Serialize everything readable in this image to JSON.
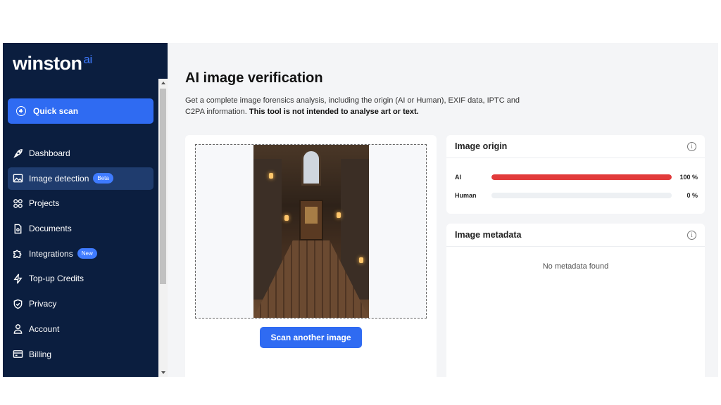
{
  "app": {
    "logo_text": "winston",
    "logo_suffix": "ai",
    "accent_color": "#2f6bf2",
    "sidebar_color": "#0b1e3f"
  },
  "sidebar": {
    "quick_scan": "Quick scan",
    "items": [
      {
        "label": "Dashboard",
        "icon": "rocket-icon"
      },
      {
        "label": "Image detection",
        "icon": "image-icon",
        "tag": "Beta",
        "active": true
      },
      {
        "label": "Projects",
        "icon": "grid-icon"
      },
      {
        "label": "Documents",
        "icon": "document-icon"
      },
      {
        "label": "Integrations",
        "icon": "puzzle-icon",
        "tag": "New"
      },
      {
        "label": "Top-up Credits",
        "icon": "lightning-icon"
      },
      {
        "label": "Privacy",
        "icon": "shield-icon"
      },
      {
        "label": "Account",
        "icon": "user-icon"
      },
      {
        "label": "Billing",
        "icon": "card-icon"
      }
    ]
  },
  "main": {
    "title": "AI image verification",
    "description": "Get a complete image forensics analysis, including the origin (AI or Human), EXIF data, IPTC and C2PA information.",
    "description_bold": "This tool is not intended to analyse art or text.",
    "scan_button": "Scan another image"
  },
  "origin": {
    "title": "Image origin",
    "rows": [
      {
        "label": "AI",
        "percent_text": "100 %",
        "fraction": 1.0,
        "color": "#e23b3b"
      },
      {
        "label": "Human",
        "percent_text": "0 %",
        "fraction": 0.0,
        "color": "#e23b3b"
      }
    ]
  },
  "metadata": {
    "title": "Image metadata",
    "empty_text": "No metadata found"
  }
}
